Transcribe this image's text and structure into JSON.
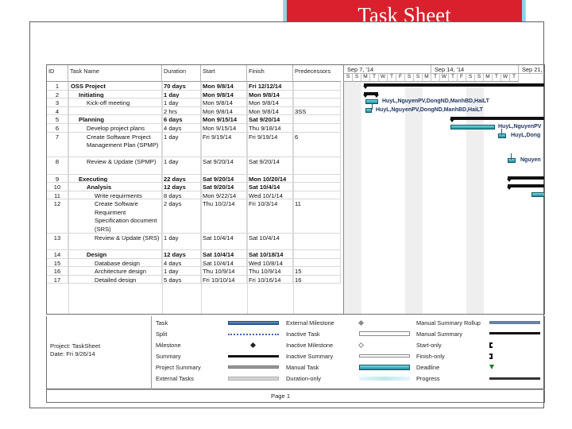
{
  "slide_title": "Task Sheet",
  "columns": {
    "id": "ID",
    "task_name": "Task Name",
    "duration": "Duration",
    "start": "Start",
    "finish": "Finish",
    "predecessors": "Predecessors"
  },
  "weeks": [
    "Sep 7, '14",
    "Sep 14, '14",
    "Sep 21,"
  ],
  "days": [
    "S",
    "S",
    "M",
    "T",
    "W",
    "T",
    "F",
    "S",
    "S",
    "M",
    "T",
    "W",
    "T",
    "F",
    "S",
    "S",
    "M",
    "T",
    "W",
    "T"
  ],
  "tasks": [
    {
      "id": "1",
      "name": "OSS Project",
      "duration": "70 days",
      "start": "Mon 9/8/14",
      "finish": "Fri 12/12/14",
      "pred": "",
      "level": 0,
      "summary": true
    },
    {
      "id": "2",
      "name": "Initiating",
      "duration": "1 day",
      "start": "Mon 9/8/14",
      "finish": "Mon 9/8/14",
      "pred": "",
      "level": 1,
      "summary": true
    },
    {
      "id": "3",
      "name": "Kick-off meeting",
      "duration": "1 day",
      "start": "Mon 9/8/14",
      "finish": "Mon 9/8/14",
      "pred": "",
      "level": 2,
      "summary": false
    },
    {
      "id": "4",
      "name": "",
      "duration": "2 hrs",
      "start": "Mon 9/8/14",
      "finish": "Mon 9/8/14",
      "pred": "3SS",
      "level": 2,
      "summary": false
    },
    {
      "id": "5",
      "name": "Planning",
      "duration": "6 days",
      "start": "Mon 9/15/14",
      "finish": "Sat 9/20/14",
      "pred": "",
      "level": 1,
      "summary": true
    },
    {
      "id": "6",
      "name": "Develop project plans",
      "duration": "4 days",
      "start": "Mon 9/15/14",
      "finish": "Thu 9/18/14",
      "pred": "",
      "level": 2,
      "summary": false
    },
    {
      "id": "7",
      "name": "Create Software Project Management Plan (SPMP)",
      "duration": "1 day",
      "start": "Fri 9/19/14",
      "finish": "Fri 9/19/14",
      "pred": "6",
      "level": 2,
      "summary": false
    },
    {
      "id": "8",
      "name": "Review & Update (SPMP)",
      "duration": "1 day",
      "start": "Sat 9/20/14",
      "finish": "Sat 9/20/14",
      "pred": "",
      "level": 2,
      "summary": false
    },
    {
      "id": "9",
      "name": "Executing",
      "duration": "22 days",
      "start": "Sat 9/20/14",
      "finish": "Mon 10/20/14",
      "pred": "",
      "level": 1,
      "summary": true
    },
    {
      "id": "10",
      "name": "Analysis",
      "duration": "12 days",
      "start": "Sat 9/20/14",
      "finish": "Sat 10/4/14",
      "pred": "",
      "level": 2,
      "summary": true
    },
    {
      "id": "11",
      "name": "Write requirments",
      "duration": "8 days",
      "start": "Mon 9/22/14",
      "finish": "Wed 10/1/14",
      "pred": "",
      "level": 3,
      "summary": false
    },
    {
      "id": "12",
      "name": "Create Software Requirment Specification document (SRS)",
      "duration": "2 days",
      "start": "Thu 10/2/14",
      "finish": "Fri 10/3/14",
      "pred": "11",
      "level": 3,
      "summary": false
    },
    {
      "id": "13",
      "name": "Review & Update (SRS)",
      "duration": "1 day",
      "start": "Sat 10/4/14",
      "finish": "Sat 10/4/14",
      "pred": "",
      "level": 3,
      "summary": false
    },
    {
      "id": "14",
      "name": "Design",
      "duration": "12 days",
      "start": "Sat 10/4/14",
      "finish": "Sat 10/18/14",
      "pred": "",
      "level": 2,
      "summary": true
    },
    {
      "id": "15",
      "name": "Database design",
      "duration": "4 days",
      "start": "Sat 10/4/14",
      "finish": "Wed 10/8/14",
      "pred": "",
      "level": 3,
      "summary": false
    },
    {
      "id": "16",
      "name": "Architecture design",
      "duration": "1 day",
      "start": "Thu 10/9/14",
      "finish": "Thu 10/9/14",
      "pred": "15",
      "level": 3,
      "summary": false
    },
    {
      "id": "17",
      "name": "Detailed design",
      "duration": "5 days",
      "start": "Fri 10/10/14",
      "finish": "Fri 10/16/14",
      "pred": "16",
      "level": 3,
      "summary": false
    }
  ],
  "bar_labels": {
    "t3": "HuyL,NguyenPV,DongND,ManhBD,HaiLT",
    "t4": "HuyL,NguyenPV,DongND,ManhBD,HaiLT",
    "t6": "HuyL,NguyenPV",
    "t7": "HuyL,Dong",
    "t8": "Nguyen"
  },
  "project": {
    "name": "Project: TaskSheet",
    "date": "Date: Fri 9/26/14"
  },
  "legend": {
    "task": "Task",
    "split": "Split",
    "milestone": "Milestone",
    "summary": "Summary",
    "project_summary": "Project Summary",
    "external_tasks": "External Tasks",
    "external_milestone": "External Milestone",
    "inactive_task": "Inactive Task",
    "inactive_milestone": "Inactive Milestone",
    "inactive_summary": "Inactive Summary",
    "manual_task": "Manual Task",
    "duration_only": "Duration-only",
    "manual_summary_rollup": "Manual Summary Rollup",
    "manual_summary": "Manual Summary",
    "start_only": "Start-only",
    "finish_only": "Finish-only",
    "deadline": "Deadline",
    "progress": "Progress"
  },
  "footer": {
    "page": "Page 1"
  }
}
